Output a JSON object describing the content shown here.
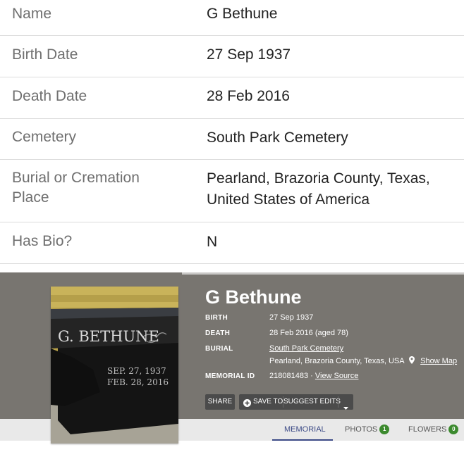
{
  "details": {
    "name_label": "Name",
    "name_value": "G Bethune",
    "birth_label": "Birth Date",
    "birth_value": "27 Sep 1937",
    "death_label": "Death Date",
    "death_value": "28 Feb 2016",
    "cemetery_label": "Cemetery",
    "cemetery_value": "South Park Cemetery",
    "burial_label_1": "Burial or Cremation",
    "burial_label_2": "Place",
    "burial_value_1": "Pearland, Brazoria County, Texas,",
    "burial_value_2": "United States of America",
    "bio_label": "Has Bio?",
    "bio_value": "N"
  },
  "memorial": {
    "title": "G Bethune",
    "birth_label": "BIRTH",
    "birth_value": "27 Sep 1937",
    "death_label": "DEATH",
    "death_value": "28 Feb 2016 (aged 78)",
    "burial_label": "BURIAL",
    "cemetery_link": "South Park Cemetery",
    "location": "Pearland, Brazoria County, Texas, USA",
    "show_map": "Show Map",
    "memorial_id_label": "MEMORIAL ID",
    "memorial_id": "218081483",
    "separator": "·",
    "view_source": "View Source",
    "headstone_name": "G. BETHUNE",
    "headstone_date1": "SEP. 27, 1937",
    "headstone_date2": "FEB. 28, 2016"
  },
  "actions": {
    "share": "SHARE",
    "save_to": "SAVE TO",
    "suggest_edits": "SUGGEST EDITS"
  },
  "tabs": {
    "memorial": "MEMORIAL",
    "photos": "PHOTOS",
    "photos_count": "1",
    "flowers": "FLOWERS",
    "flowers_count": "0"
  },
  "icons": [
    "plus-circle-icon",
    "map-pin-icon",
    "caret-down-icon"
  ],
  "colors": {
    "banner": "#787570",
    "tab_active": "#3c4a86",
    "badge": "#3c8a2e",
    "button": "#4b4b4b"
  }
}
